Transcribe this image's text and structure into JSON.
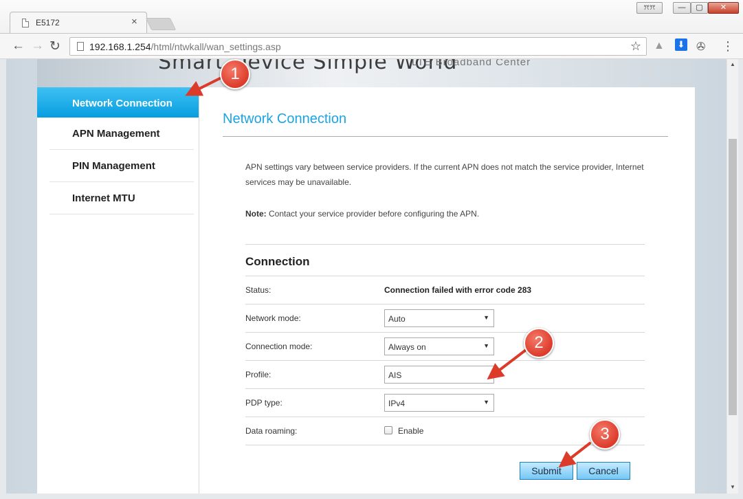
{
  "browser": {
    "tab_title": "E5172",
    "tab_close": "×",
    "url_host": "192.168.1.254",
    "url_path": "/html/ntwkall/wan_settings.asp",
    "profile_label": "ꔫꔫ",
    "window_min": "—",
    "window_max": "▢",
    "window_close": "✕"
  },
  "banner": {
    "slogan": "Smart Device   Simple World",
    "product": "LTE  Broadband  Center"
  },
  "sidebar": {
    "items": [
      {
        "label": "Network Connection"
      },
      {
        "label": "APN Management"
      },
      {
        "label": "PIN Management"
      },
      {
        "label": "Internet MTU"
      }
    ]
  },
  "main": {
    "title": "Network Connection",
    "description": "APN settings vary between service providers. If the current APN does not match the service provider, Internet services may be unavailable.",
    "note_label": "Note:",
    "note_text": " Contact your service provider before configuring the APN.",
    "section_title": "Connection",
    "status_label": "Status:",
    "status_value": "Connection failed with error code 283",
    "network_mode_label": "Network mode:",
    "network_mode_value": "Auto",
    "connection_mode_label": "Connection mode:",
    "connection_mode_value": "Always on",
    "profile_label": "Profile:",
    "profile_value": "AIS",
    "pdp_type_label": "PDP type:",
    "pdp_type_value": "IPv4",
    "data_roaming_label": "Data roaming:",
    "data_roaming_option": "Enable",
    "submit_label": "Submit",
    "cancel_label": "Cancel"
  },
  "annotations": {
    "badge_1": "1",
    "badge_2": "2",
    "badge_3": "3",
    "color": "#dd3b2a"
  },
  "colors": {
    "accent": "#1aa4e4",
    "active_nav": "#069ee0",
    "button": "#76c8f5"
  }
}
